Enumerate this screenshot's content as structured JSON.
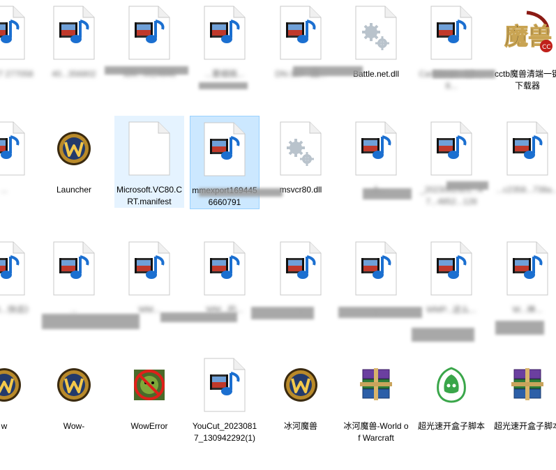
{
  "rows": [
    [
      {
        "name": "397277 277058",
        "icon": "media-file-icon",
        "blurred": true,
        "clip": true
      },
      {
        "name": "40...356802",
        "icon": "media-file-icon",
        "blurred": true
      },
      {
        "name": "320...0114945",
        "icon": "media-file-icon",
        "blurred": true
      },
      {
        "name": "...要细搞...",
        "icon": "media-file-icon",
        "blurred": true
      },
      {
        "name": "DN-367...回...",
        "icon": "media-file-icon",
        "blurred": true
      },
      {
        "name": "Battle.net.dll",
        "icon": "gear-file-icon",
        "blurred": false
      },
      {
        "name": "Caribbean...12-...8...",
        "icon": "media-file-icon",
        "blurred": true
      },
      {
        "name": "cctb魔兽清端一键下载器",
        "icon": "mo-xi-logo-icon",
        "blurred": false
      }
    ],
    [
      {
        "name": "...",
        "icon": "media-file-icon",
        "blurred": true,
        "clip": true
      },
      {
        "name": "Launcher",
        "icon": "wow-logo-icon",
        "blurred": false
      },
      {
        "name": "Microsoft.VC80.CRT.manifest",
        "icon": "blank-file-icon",
        "blurred": false,
        "hover": true
      },
      {
        "name": "mmexport1694456660791",
        "icon": "media-file-icon",
        "blurred": false,
        "selected": true
      },
      {
        "name": "msvcr80.dll",
        "icon": "gear-file-icon",
        "blurred": false
      },
      {
        "name": "...人...",
        "icon": "media-file-icon",
        "blurred": true
      },
      {
        "name": "_2023052321...47...4852...128",
        "icon": "media-file-icon",
        "blurred": true
      },
      {
        "name": "...c2358...738a...",
        "icon": "media-file-icon",
        "blurred": true
      }
    ],
    [
      {
        "name": "《一本...快适》",
        "icon": "media-file-icon",
        "blurred": true,
        "clip": true
      },
      {
        "name": "...",
        "icon": "media-file-icon",
        "blurred": true
      },
      {
        "name": "WM...",
        "icon": "media-file-icon",
        "blurred": true
      },
      {
        "name": "WM...的...",
        "icon": "media-file-icon",
        "blurred": true
      },
      {
        "name": "...",
        "icon": "media-file-icon",
        "blurred": true
      },
      {
        "name": "...",
        "icon": "media-file-icon",
        "blurred": true
      },
      {
        "name": "WMP...这么...",
        "icon": "media-file-icon",
        "blurred": true
      },
      {
        "name": "W...神...",
        "icon": "media-file-icon",
        "blurred": true
      }
    ],
    [
      {
        "name": "w",
        "icon": "wow-logo-icon",
        "blurred": false,
        "clip": true
      },
      {
        "name": "Wow-",
        "icon": "wow-logo-icon",
        "blurred": false
      },
      {
        "name": "WowError",
        "icon": "wow-error-icon",
        "blurred": false
      },
      {
        "name": "YouCut_20230817_130942292(1)",
        "icon": "media-file-icon",
        "blurred": false
      },
      {
        "name": "冰河魔兽",
        "icon": "wow-logo-icon",
        "blurred": false
      },
      {
        "name": "冰河魔兽-World of Warcraft",
        "icon": "winrar-icon",
        "blurred": false
      },
      {
        "name": "超光速开盒子脚本",
        "icon": "green-app-icon",
        "blurred": false
      },
      {
        "name": "超光速开盒子脚本",
        "icon": "winrar-icon",
        "blurred": false
      }
    ]
  ]
}
